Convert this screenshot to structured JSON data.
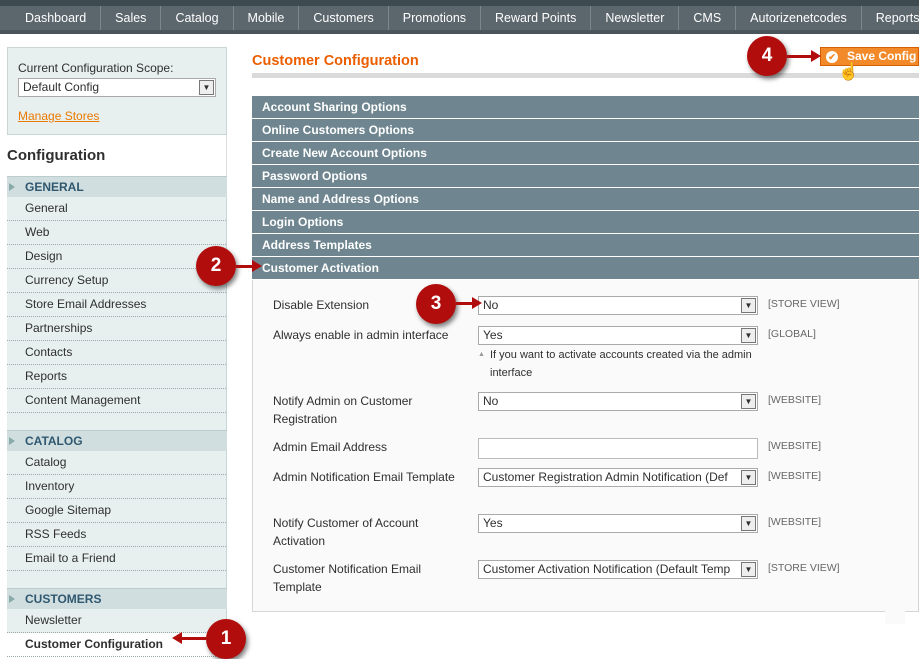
{
  "nav": [
    "Dashboard",
    "Sales",
    "Catalog",
    "Mobile",
    "Customers",
    "Promotions",
    "Reward Points",
    "Newsletter",
    "CMS",
    "Autorizenetcodes",
    "Reports"
  ],
  "sidebar": {
    "scope_label": "Current Configuration Scope:",
    "scope_value": "Default Config",
    "manage_stores": "Manage Stores",
    "title": "Configuration",
    "sections": [
      {
        "label": "GENERAL",
        "items": [
          "General",
          "Web",
          "Design",
          "Currency Setup",
          "Store Email Addresses",
          "Partnerships",
          "Contacts",
          "Reports",
          "Content Management"
        ]
      },
      {
        "label": "CATALOG",
        "items": [
          "Catalog",
          "Inventory",
          "Google Sitemap",
          "RSS Feeds",
          "Email to a Friend"
        ]
      },
      {
        "label": "CUSTOMERS",
        "items": [
          "Newsletter",
          "Customer Configuration"
        ]
      }
    ]
  },
  "main": {
    "title": "Customer Configuration",
    "save_label": "Save Config",
    "groups": [
      "Account Sharing Options",
      "Online Customers Options",
      "Create New Account Options",
      "Password Options",
      "Name and Address Options",
      "Login Options",
      "Address Templates",
      "Customer Activation"
    ],
    "fields": [
      {
        "label": "Disable Extension",
        "value": "No",
        "scope": "[STORE VIEW]"
      },
      {
        "label": "Always enable in admin interface",
        "value": "Yes",
        "scope": "[GLOBAL]",
        "note": "If you want to activate accounts created via the admin interface"
      },
      {
        "label": "Notify Admin on Customer Registration",
        "value": "No",
        "scope": "[WEBSITE]"
      },
      {
        "label": "Admin Email Address",
        "value": "",
        "scope": "[WEBSITE]"
      },
      {
        "label": "Admin Notification Email Template",
        "value": "Customer Registration Admin Notification (Def",
        "scope": "[WEBSITE]"
      },
      {
        "label": "Notify Customer of Account Activation",
        "value": "Yes",
        "scope": "[WEBSITE]"
      },
      {
        "label": "Customer Notification Email Template",
        "value": "Customer Activation Notification (Default Temp",
        "scope": "[STORE VIEW]"
      }
    ]
  },
  "annotations": [
    "1",
    "2",
    "3",
    "4"
  ],
  "colors": {
    "accent": "#eb5e00",
    "nav": "#5c666d",
    "group_header": "#6f8690",
    "marker": "#b10d0d"
  }
}
